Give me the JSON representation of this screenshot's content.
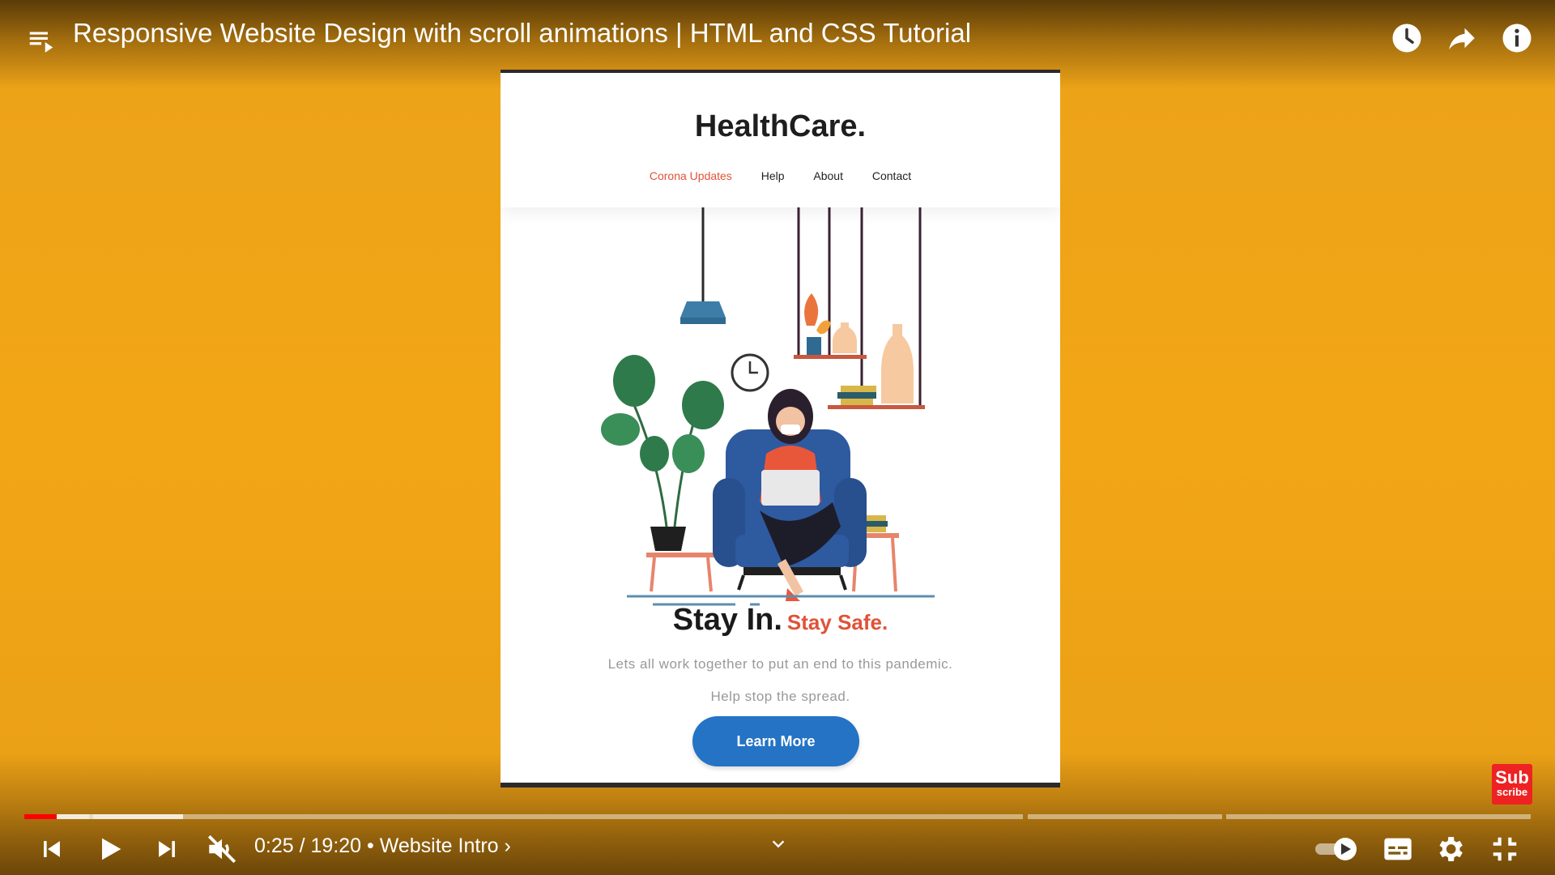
{
  "player": {
    "title": "Responsive Website Design with scroll animations | HTML and CSS Tutorial",
    "time_current": "0:25",
    "time_total": "19:20",
    "time_separator": " / ",
    "chapter": "Website Intro",
    "progress_played_fraction": 0.0215,
    "progress_buffered_fraction": 0.1055,
    "icons": {
      "playlist": "playlist-icon",
      "watch_later": "clock-icon",
      "share": "share-icon",
      "info": "info-icon",
      "previous": "previous-icon",
      "play": "play-icon",
      "next": "next-icon",
      "mute": "volume-muted-icon",
      "chevron": "chevron-down-icon",
      "autoplay": "autoplay-toggle-icon",
      "subtitles": "subtitles-icon",
      "settings": "gear-icon",
      "fullscreen_exit": "fullscreen-exit-icon"
    },
    "subscribe_badge": {
      "line1": "Sub",
      "line2": "scribe"
    }
  },
  "video_frame": {
    "brand": "HealthCare.",
    "nav": [
      "Corona Updates",
      "Help",
      "About",
      "Contact"
    ],
    "hero_title_main": "Stay In.",
    "hero_title_accent": "Stay Safe.",
    "hero_text_line1": "Lets all work together to put an end to this pandemic.",
    "hero_text_line2": "Help stop the spread.",
    "button": "Learn More"
  },
  "colors": {
    "background": "#f2a616",
    "accent_red": "#e05238",
    "button_blue": "#2473c5",
    "progress_red": "#ff0000"
  }
}
